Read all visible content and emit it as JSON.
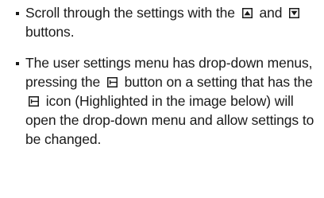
{
  "instructions": [
    {
      "before": "Scroll through the settings with the",
      "icon_1": "scroll-up-button-icon",
      "middle": "and",
      "icon_2": "scroll-down-button-icon",
      "after": "buttons."
    },
    {
      "part_1": "The user settings menu has drop-down menus, pressing the",
      "icon_1": "drop-down-button-icon",
      "part_2": "button on a setting that has the",
      "icon_2": "drop-down-button-icon",
      "part_3": "icon (Highlighted in the image below) will open the drop-down menu and allow settings to be changed."
    }
  ]
}
